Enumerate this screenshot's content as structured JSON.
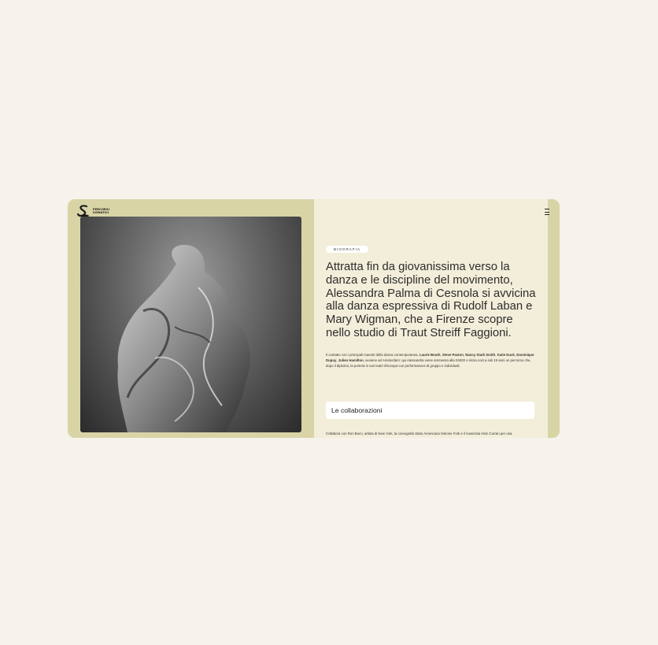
{
  "brand": {
    "line1": "PERCORSI",
    "line2": "SOMATICI",
    "logo_icon": "brand-s-icon"
  },
  "menu": {
    "icon": "hamburger-menu-icon"
  },
  "section_tag": "BIOGRAFIA",
  "headline": "Attratta fin da giovanissima verso la danza e le discipline del movimento, Alessandra Palma di Cesnola si avvicina alla danza espressiva di Rudolf Laban e Mary Wigman, che a Firenze scopre nello studio di Traut Streiff Faggioni.",
  "body": {
    "p1": "Il contatto con i principali maestri della danza contemporanea, ",
    "names": [
      "Laurie Booth",
      "Steve Paxton",
      "Nancy Stark Smith",
      "Katie Duck",
      "Dominique Dupuy",
      "Julien Hamilton"
    ],
    "sep1": ", ",
    "p2": ", avviene ad Amsterdam: qui Alessandra viene ammessa alla SNDO e inizia così a soli 19 anni un percorso che, dopo il diploma, la porterà in vari teatri d'Europa con performances di gruppo e individuali."
  },
  "collab_heading": "Le collaborazioni",
  "collab_text": "Collabora con Ron Burci, artista di New York, la coreografa Stato Americana Simone Forti e il musicista Alvin Curran per una",
  "colors": {
    "page_bg": "#f5f3eb",
    "frame": "#d9d4a6",
    "panel": "#f3eeda"
  }
}
